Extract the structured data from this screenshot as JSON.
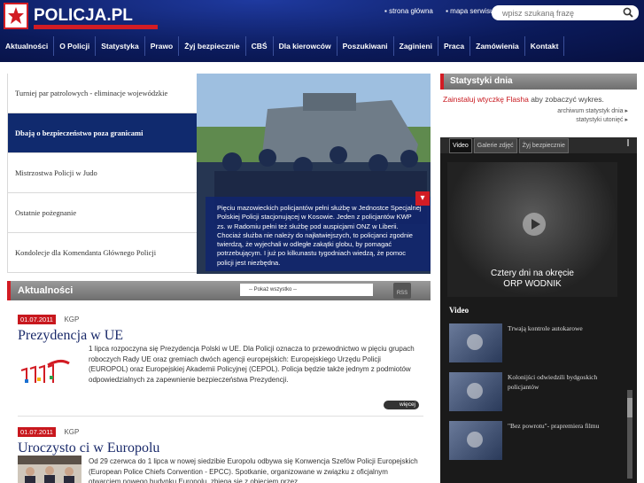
{
  "header": {
    "logo_text": "POLICJA.PL",
    "top_links": [
      "strona główna",
      "mapa serwisu"
    ],
    "search_placeholder": "wpisz szukaną frazę"
  },
  "nav": {
    "items": [
      "Aktualności",
      "O Policji",
      "Statystyka",
      "Prawo",
      "Żyj bezpiecznie",
      "CBŚ",
      "Dla kierowców",
      "Poszukiwani",
      "Zaginieni",
      "Praca",
      "Zamówienia",
      "Kontakt"
    ]
  },
  "slider": {
    "items": [
      "Turniej par patrolowych - eliminacje wojewódzkie",
      "Dbają o bezpieczeństwo poza granicami",
      "Mistrzostwa Policji w Judo",
      "Ostatnie pożegnanie",
      "Kondolecje dla Komendanta Głównego Policji"
    ],
    "caption": "Pięciu mazowieckich policjantów pełni służbę w Jednostce Specjalnej Polskiej Policji stacjonującej w Kosowie. Jeden z policjantów KWP zs. w Radomiu pełni też służbę pod auspicjami ONZ w Liberii. Chociaż służba nie należy do najłatwiejszych, to policjanci zgodnie twierdzą, że wyjechali w odległe zakątki globu, by pomagać potrzebującym. I już po kilkunastu tygodniach wiedzą, że pomoc policji jest niezbędna."
  },
  "news": {
    "title": "Aktualności",
    "select_label": "-- Pokaż wszystko --",
    "rss": "RSS",
    "more": "więcej",
    "articles": [
      {
        "date": "01.07.2011",
        "source": "KGP",
        "title": "Prezydencja w UE",
        "body": "1 lipca rozpoczyna się Prezydencja Polski w UE. Dla Policji oznacza to przewodnictwo w pięciu grupach roboczych Rady UE oraz gremiach dwóch agencji europejskich: Europejskiego Urzędu Policji (EUROPOL) oraz Europejskiej Akademii Policyjnej (CEPOL). Policja będzie także jednym z podmiotów odpowiedzialnych za zapewnienie bezpieczeństwa Prezydencji."
      },
      {
        "date": "01.07.2011",
        "source": "KGP",
        "title": "Uroczysto ci w Europolu",
        "body": "Od 29 czerwca do 1 lipca w nowej siedzibie Europolu odbywa się Konwencja Szefów Policji Europejskich (European Police Chiefs Convention - EPCC). Spotkanie, organizowane w związku z oficjalnym otwarciem nowego budynku Europolu, zbiega się z objęciem przez"
      }
    ]
  },
  "stats": {
    "title": "Statystyki dnia",
    "flash_link": "Zainstaluj wtyczkę Flasha",
    "flash_rest": " aby zobaczyć wykres.",
    "link1": "archiwum statystyk dnia",
    "link2": "statystyki utonięć"
  },
  "media": {
    "tabs": [
      "Video",
      "Galerie zdjęć",
      "Żyj bezpiecznie"
    ],
    "video_title_line1": "Cztery dni na okręcie",
    "video_title_line2": "ORP WODNIK",
    "section_label": "Video",
    "items": [
      "Trwają kontrole autokarowe",
      "Kolonijści odwiedzili bydgoskich policjantów",
      "\"Bez powrotu\"- prapremiera filmu"
    ]
  }
}
